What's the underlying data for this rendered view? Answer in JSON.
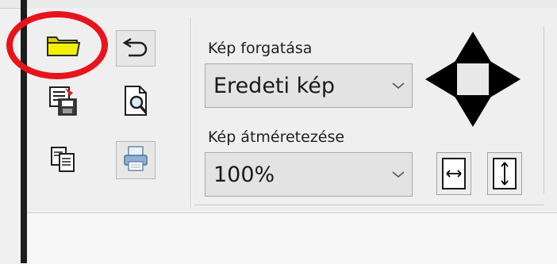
{
  "toolbar": {
    "icons": {
      "open": "folder-icon",
      "undo": "undo-arrow-icon",
      "save": "save-disk-icon",
      "preview": "print-preview-icon",
      "copy": "copy-icon",
      "print": "print-icon"
    }
  },
  "rotation": {
    "label": "Kép forgatása",
    "selected": "Eredeti kép"
  },
  "resize": {
    "label": "Kép átméretezése",
    "selected": "100%"
  },
  "colors": {
    "highlight": "#e8141b",
    "folder": "#f4f000"
  }
}
